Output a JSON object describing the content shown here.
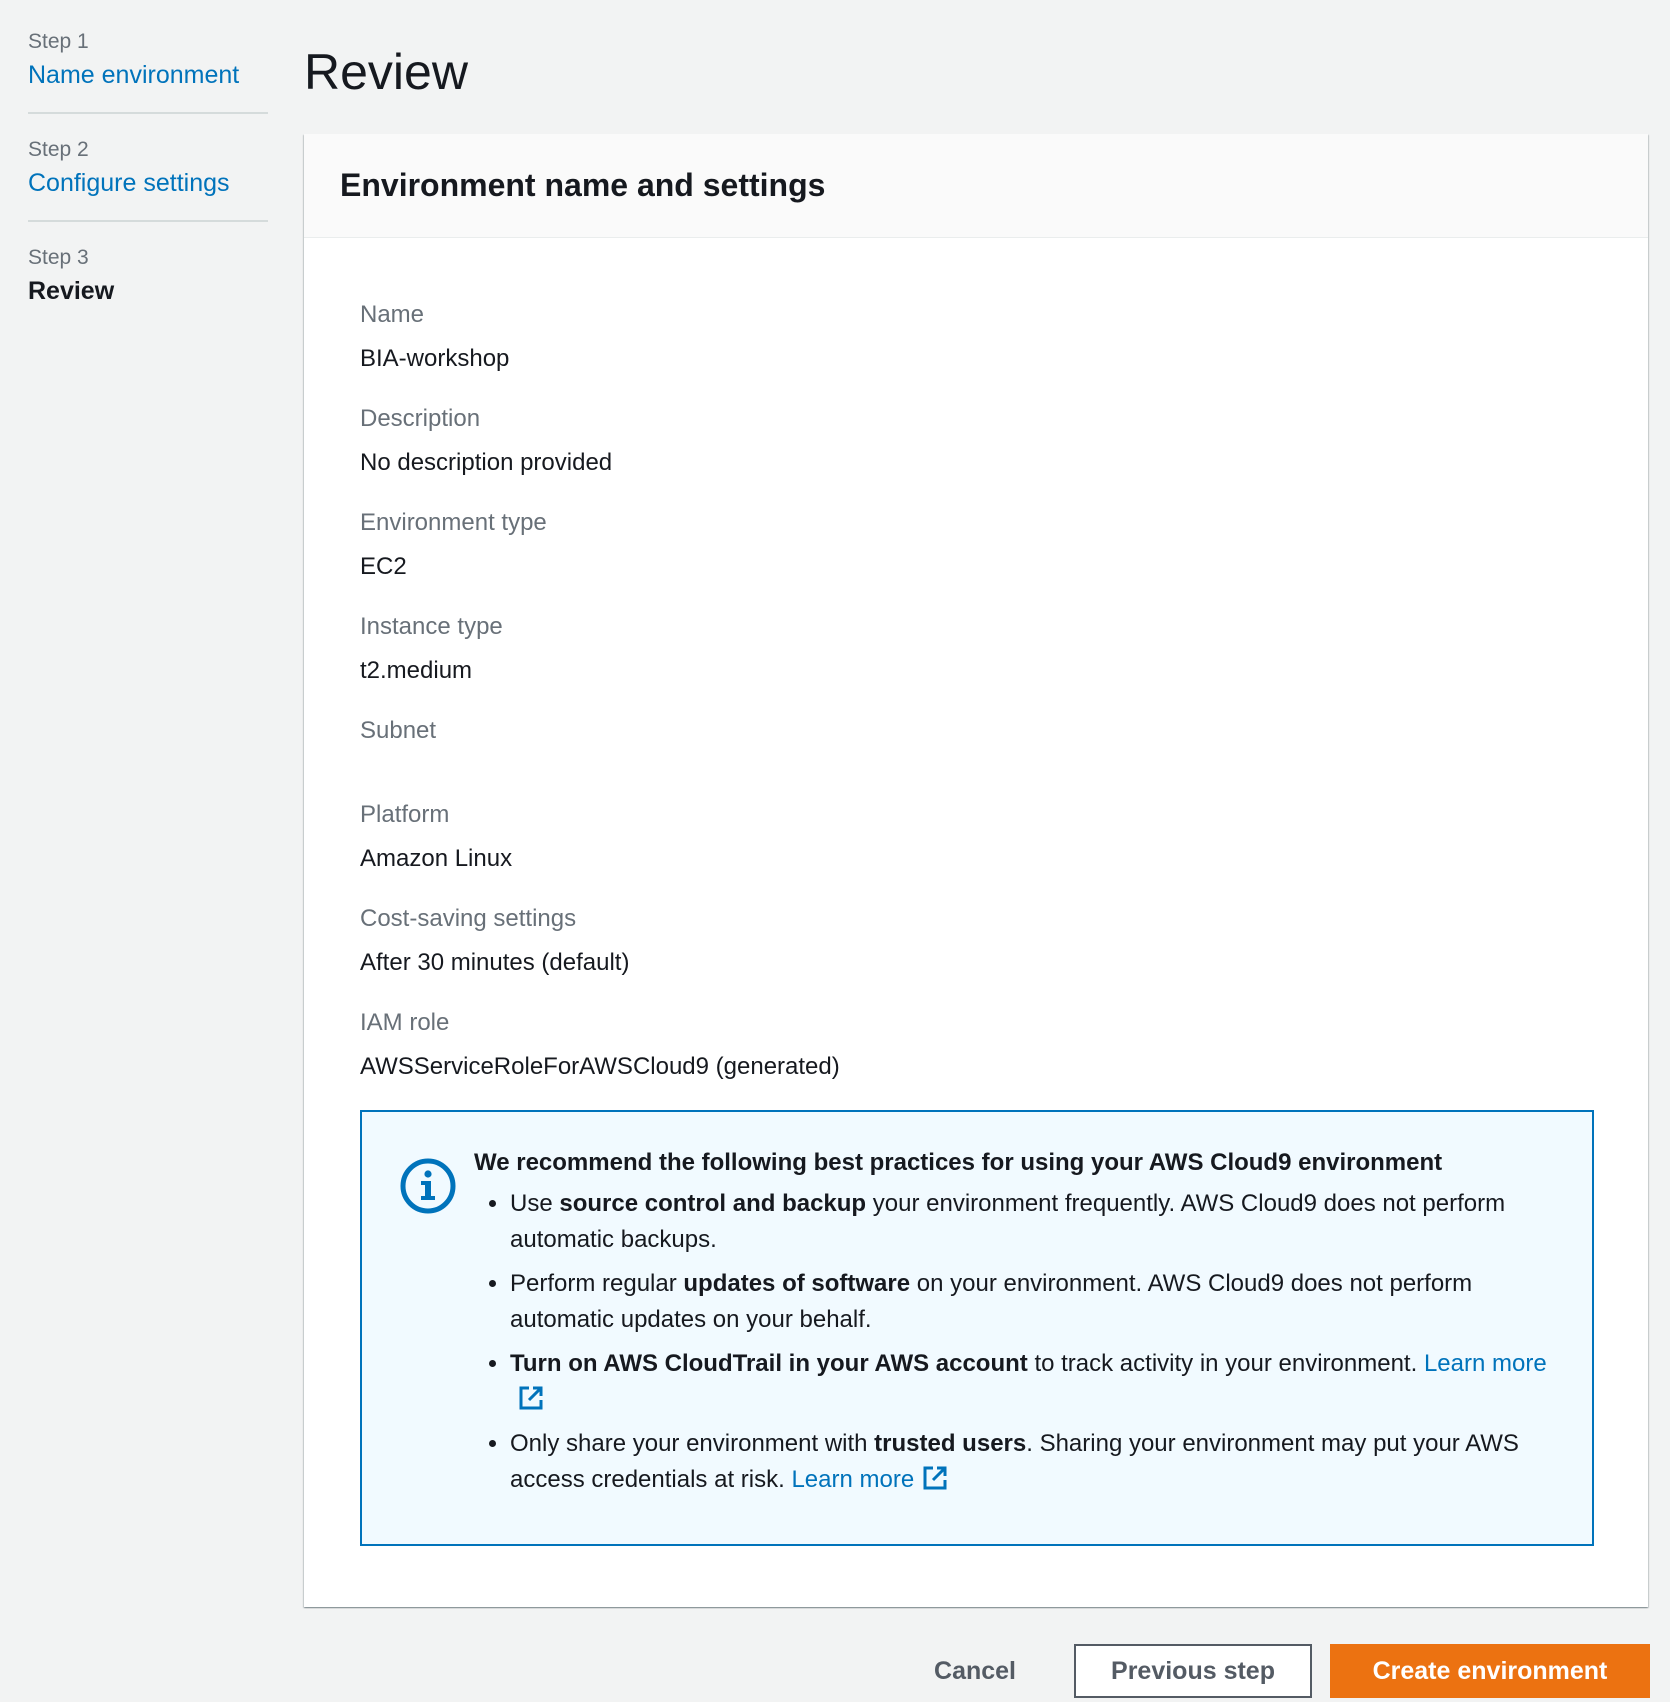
{
  "steps": [
    {
      "num": "Step 1",
      "label": "Name environment",
      "state": "link"
    },
    {
      "num": "Step 2",
      "label": "Configure settings",
      "state": "link"
    },
    {
      "num": "Step 3",
      "label": "Review",
      "state": "current"
    }
  ],
  "page_title": "Review",
  "card": {
    "title": "Environment name and settings",
    "fields": [
      {
        "label": "Name",
        "value": "BIA-workshop"
      },
      {
        "label": "Description",
        "value": "No description provided"
      },
      {
        "label": "Environment type",
        "value": "EC2"
      },
      {
        "label": "Instance type",
        "value": "t2.medium"
      },
      {
        "label": "Subnet",
        "value": ""
      },
      {
        "label": "Platform",
        "value": "Amazon Linux"
      },
      {
        "label": "Cost-saving settings",
        "value": "After 30 minutes (default)"
      },
      {
        "label": "IAM role",
        "value": "AWSServiceRoleForAWSCloud9 (generated)"
      }
    ]
  },
  "alert": {
    "icon": "info-icon",
    "title": "We recommend the following best practices for using your AWS Cloud9 environment",
    "items": [
      {
        "pre": "Use ",
        "bold": "source control and backup",
        "post": " your environment frequently. AWS Cloud9 does not perform automatic backups.",
        "link": ""
      },
      {
        "pre": "Perform regular ",
        "bold": "updates of software",
        "post": " on your environment. AWS Cloud9 does not perform automatic updates on your behalf.",
        "link": ""
      },
      {
        "pre": "",
        "bold": "Turn on AWS CloudTrail in your AWS account",
        "post": " to track activity in your environment. ",
        "link": "Learn more"
      },
      {
        "pre": "Only share your environment with ",
        "bold": "trusted users",
        "post": ". Sharing your environment may put your AWS access credentials at risk. ",
        "link": "Learn more"
      }
    ]
  },
  "footer": {
    "cancel": "Cancel",
    "previous": "Previous step",
    "create": "Create environment"
  },
  "colors": {
    "link": "#0073bb",
    "primary_button": "#ec7211",
    "alert_border": "#0073bb",
    "alert_background": "#f1faff",
    "page_background": "#f2f3f3"
  }
}
